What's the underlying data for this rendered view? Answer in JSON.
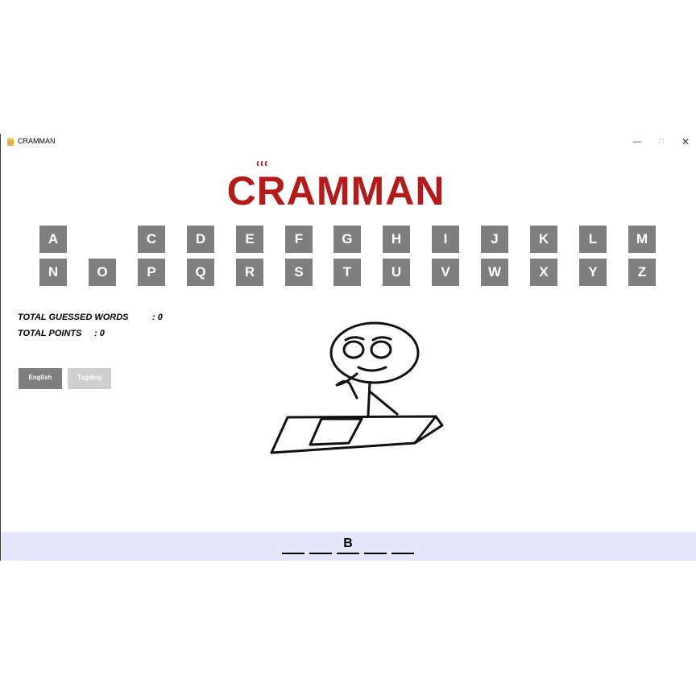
{
  "window": {
    "title": "CRAMMAN"
  },
  "logo": {
    "text": "CRAMMAN",
    "color": "#b31b1b"
  },
  "keyboard": {
    "row1": [
      "A",
      "",
      "C",
      "D",
      "E",
      "F",
      "G",
      "H",
      "I",
      "J",
      "K",
      "L",
      "M"
    ],
    "row2": [
      "N",
      "O",
      "P",
      "Q",
      "R",
      "S",
      "T",
      "U",
      "V",
      "W",
      "X",
      "Y",
      "Z"
    ],
    "used_letters": [
      "B"
    ]
  },
  "stats": {
    "guessed_label": "TOTAL GUESSED WORDS",
    "guessed_value": ": 0",
    "points_label": "TOTAL POINTS",
    "points_value": ": 0"
  },
  "language": {
    "english": "English",
    "tagalog": "Tagalog",
    "selected": "English"
  },
  "word": {
    "slots": [
      "",
      "",
      "B",
      "",
      ""
    ]
  },
  "colors": {
    "key_bg": "#7f7f7f",
    "word_bar_bg": "#e6e6fa",
    "inactive_btn": "#cfcfcf"
  }
}
